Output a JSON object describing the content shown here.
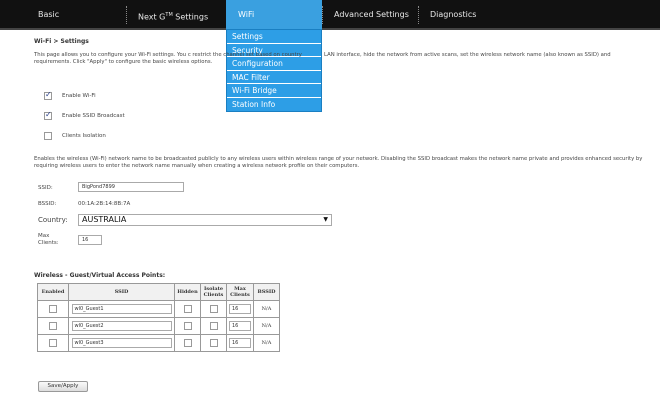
{
  "nav": {
    "items": [
      {
        "label": "Basic"
      },
      {
        "label": "Next G",
        "sup": "TM",
        "suffix": " Settings"
      },
      {
        "label": "WiFi"
      },
      {
        "label": "Advanced Settings"
      },
      {
        "label": "Diagnostics"
      }
    ],
    "active": "WiFi"
  },
  "dropdown": {
    "items": [
      "Settings",
      "Security",
      "Configuration",
      "MAC Filter",
      "Wi-Fi Bridge",
      "Station Info"
    ]
  },
  "breadcrumb": "Wi-Fi > Settings",
  "description": {
    "left": "This page allows you to configure your Wi-Fi settings. You c restrict the channel set based on country requirements. Click \"Apply\" to configure the basic wireless options.",
    "right": "LAN interface, hide the network from active scans, set the wireless network name (also known as SSID) and"
  },
  "checkboxes": [
    {
      "label": "Enable Wi-Fi",
      "checked": true
    },
    {
      "label": "Enable SSID Broadcast",
      "checked": true
    },
    {
      "label": "Clients Isolation",
      "checked": false
    }
  ],
  "ssid_broadcast_note": "Enables the wireless (Wi-Fi) network name to be broadcasted publicly to any wireless users within wireless range of your network. Disabling the SSID broadcast makes the network name private and provides enhanced security by requiring wireless users to enter the network name manually when creating a wireless network profile on their computers.",
  "fields": {
    "ssid_label": "SSID:",
    "ssid_value": "BigPond7899",
    "bssid_label": "BSSID:",
    "bssid_value": "00:1A:2B:14:8B:7A",
    "country_label": "Country:",
    "country_value": "AUSTRALIA",
    "max_clients_label": "Max Clients:",
    "max_clients_value": "16"
  },
  "ap_section_title": "Wireless - Guest/Virtual Access Points:",
  "ap_table": {
    "headers": [
      "Enabled",
      "SSID",
      "Hidden",
      "Isolate Clients",
      "Max Clients",
      "BSSID"
    ],
    "rows": [
      {
        "ssid": "wl0_Guest1",
        "max": "16",
        "bssid": "N/A"
      },
      {
        "ssid": "wl0_Guest2",
        "max": "16",
        "bssid": "N/A"
      },
      {
        "ssid": "wl0_Guest3",
        "max": "16",
        "bssid": "N/A"
      }
    ]
  },
  "apply_button": "Save/Apply"
}
